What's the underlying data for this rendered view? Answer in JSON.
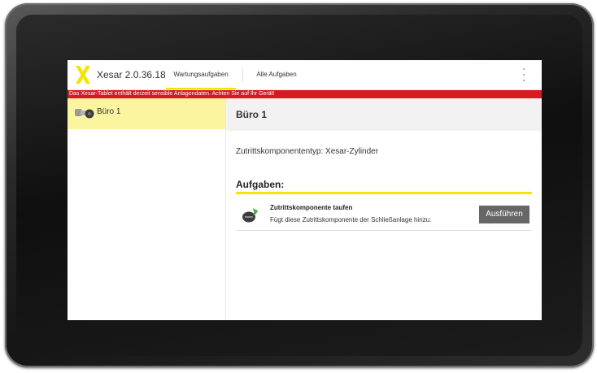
{
  "app": {
    "title": "Xesar 2.0.36.18",
    "brand_color": "#f2e600",
    "logo_icon": "xesar-x-logo"
  },
  "tabs": [
    {
      "label": "Wartungsaufgaben",
      "active": true
    },
    {
      "label": "Alle Aufgaben",
      "active": false
    }
  ],
  "menu_icon": "overflow-menu-icon",
  "warning": {
    "text": "Das Xesar-Tablet enthält derzeit sensible Anlagendaten. Achten Sie auf Ihr Gerät!",
    "color": "#d71920"
  },
  "sidebar": {
    "items": [
      {
        "label": "Büro 1",
        "icon": "cylinder-icon",
        "selected": true
      }
    ],
    "selected_color": "#fbf5a0"
  },
  "detail": {
    "title": "Büro 1",
    "type_line": "Zutrittskomponententyp: Xesar-Zylinder",
    "tasks_heading": "Aufgaben:",
    "tasks": [
      {
        "title": "Zutrittskomponente taufen",
        "description": "Fügt diese Zutrittskomponente der Schließanlage hinzu.",
        "icon": "add-component-icon",
        "button_label": "Ausführen"
      }
    ]
  }
}
